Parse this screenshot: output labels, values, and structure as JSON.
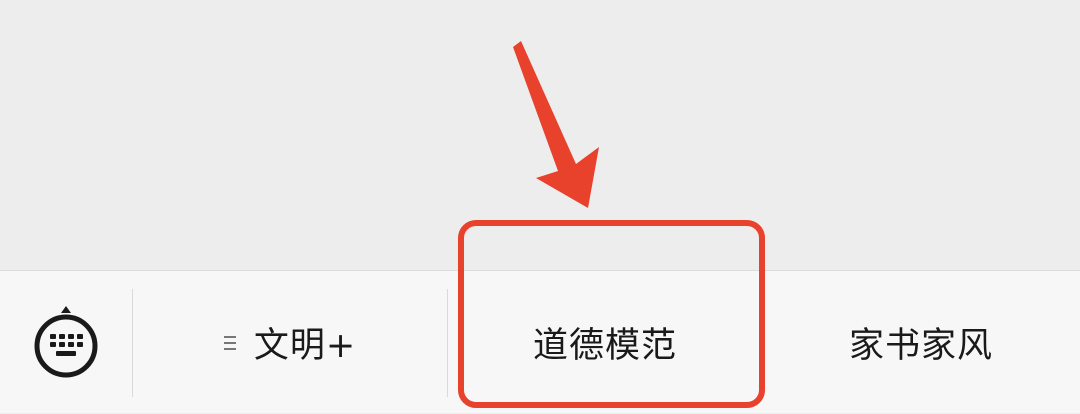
{
  "menu": {
    "items": [
      {
        "label": "文明+",
        "has_submenu": true
      },
      {
        "label": "道德模范",
        "has_submenu": false
      },
      {
        "label": "家书家风",
        "has_submenu": false
      }
    ]
  },
  "icons": {
    "keyboard": "keyboard-icon",
    "submenu": "menu-lines-icon",
    "arrow": "arrow-down-icon"
  },
  "colors": {
    "annotation": "#e8412c",
    "bar_background": "#f7f7f7",
    "page_background": "#ededed"
  }
}
